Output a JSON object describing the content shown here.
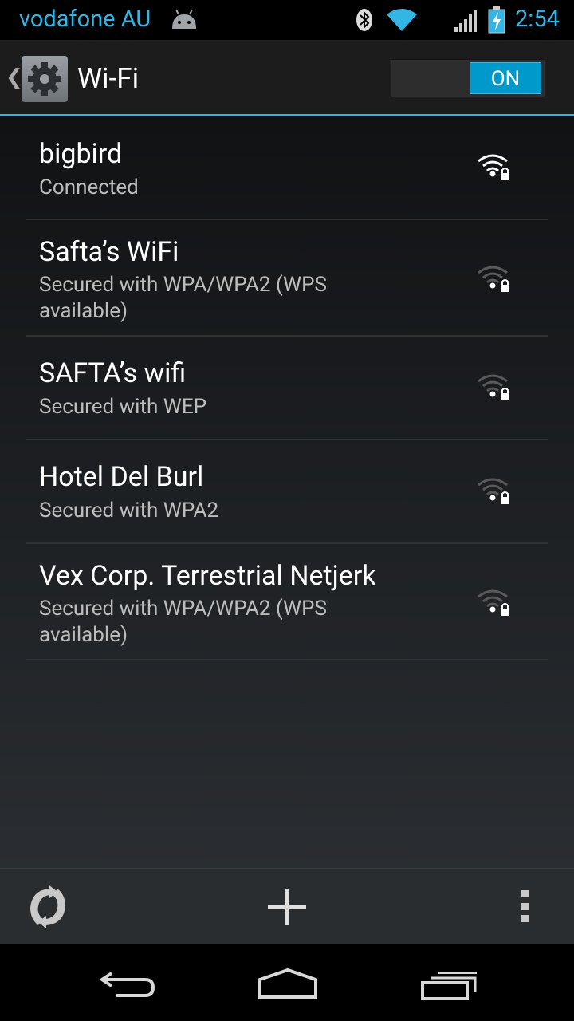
{
  "status_bar": {
    "carrier": "vodafone AU",
    "time": "2:54",
    "icons": [
      "android-icon",
      "bluetooth-icon",
      "wifi-icon",
      "cell-signal-icon",
      "battery-charging-icon"
    ]
  },
  "action_bar": {
    "title": "Wi-Fi",
    "toggle_label": "ON",
    "accent_color": "#33b5e5"
  },
  "networks": [
    {
      "ssid": "bigbird",
      "status": "Connected"
    },
    {
      "ssid": "Safta’s WiFi",
      "status": "Secured with WPA/WPA2 (WPS available)"
    },
    {
      "ssid": "SAFTA’s wifi",
      "status": "Secured with WEP"
    },
    {
      "ssid": "Hotel Del Burl",
      "status": "Secured with WPA2"
    },
    {
      "ssid": "Vex Corp. Terrestrial Netjerk",
      "status": "Secured with WPA/WPA2 (WPS available)"
    }
  ],
  "bottom_bar": {
    "icons": [
      "wps-push-icon",
      "add-network-icon",
      "overflow-menu-icon"
    ]
  },
  "nav_bar": {
    "icons": [
      "back-icon",
      "home-icon",
      "recents-icon"
    ]
  }
}
